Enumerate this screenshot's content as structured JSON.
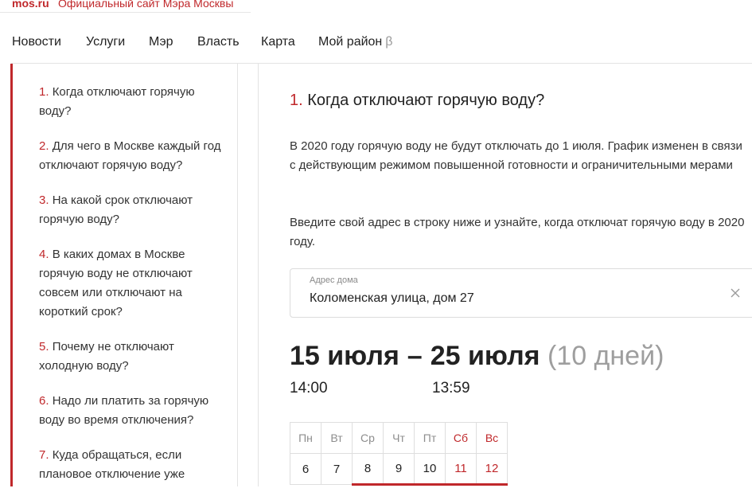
{
  "site": {
    "logo": "mos.ru",
    "subtitle": "Официальный сайт Мэра Москвы"
  },
  "nav": {
    "items": [
      "Новости",
      "Услуги",
      "Мэр",
      "Власть",
      "Карта",
      "Мой район"
    ],
    "beta": "β"
  },
  "toc": [
    {
      "num": "1.",
      "text": "Когда отключают горячую воду?"
    },
    {
      "num": "2.",
      "text": "Для чего в Москве каждый год отключают горячую воду?"
    },
    {
      "num": "3.",
      "text": "На какой срок отключают горячую воду?"
    },
    {
      "num": "4.",
      "text": "В каких домах в Москве горячую воду не отключают совсем или отключают на короткий срок?"
    },
    {
      "num": "5.",
      "text": "Почему не отключают холодную воду?"
    },
    {
      "num": "6.",
      "text": "Надо ли платить за горячую воду во время отключения?"
    },
    {
      "num": "7.",
      "text": "Куда обращаться, если плановое отключение уже"
    }
  ],
  "article": {
    "num": "1.",
    "title": "Когда отключают горячую воду?",
    "para1": "В 2020 году горячую воду не будут отключать до 1 июля. График изменен в связи с действующим режимом повышенной готовности и ограничительными мерами",
    "para2": "Введите свой адрес в строку ниже и узнайте, когда отключат горячую воду в 2020 году."
  },
  "address": {
    "label": "Адрес дома",
    "value": "Коломенская улица, дом 27"
  },
  "period": {
    "start": "15 июля",
    "dash": "–",
    "end": "25 июля",
    "days": "(10 дней)",
    "start_time": "14:00",
    "end_time": "13:59"
  },
  "calendar": {
    "weekdays": [
      "Пн",
      "Вт",
      "Ср",
      "Чт",
      "Пт",
      "Сб",
      "Вс"
    ],
    "week": [
      "6",
      "7",
      "8",
      "9",
      "10",
      "11",
      "12"
    ]
  },
  "colors": {
    "accent": "#c0282b",
    "muted": "#9e9e9e"
  }
}
